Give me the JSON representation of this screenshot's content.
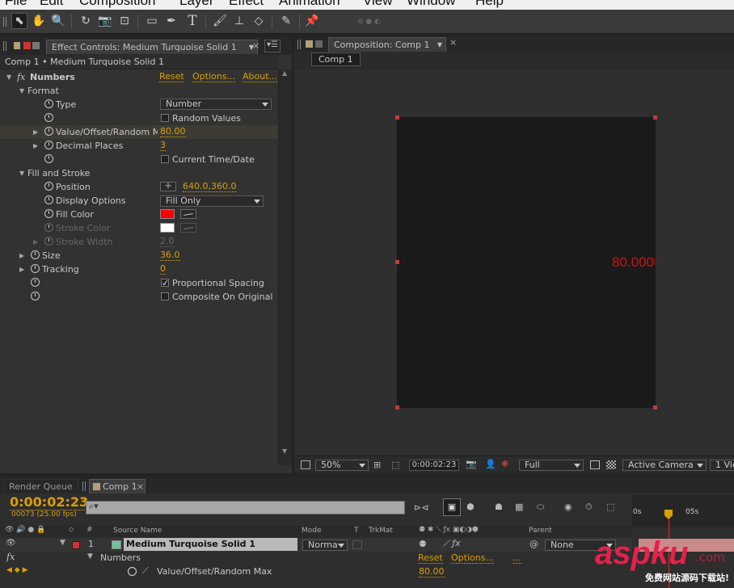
{
  "menu": [
    "File",
    "Edit",
    "Composition",
    "Layer",
    "Effect",
    "Animation",
    "View",
    "Window",
    "Help"
  ],
  "toolbar": {
    "tools": [
      "selection-tool",
      "hand-tool",
      "zoom-tool",
      "rotation-tool",
      "camera-tool",
      "pan-behind-tool",
      "rectangle-tool",
      "pen-tool",
      "type-tool",
      "brush-tool",
      "clone-stamp-tool",
      "eraser-tool",
      "roto-brush-tool",
      "puppet-pin-tool"
    ],
    "glyphs": [
      "⬉",
      "✋",
      "🔍",
      "↻",
      "📷",
      "⊡",
      "▭",
      "✒",
      "T",
      "🖌",
      "⊥",
      "◇",
      "✎",
      "📌"
    ]
  },
  "effect_controls": {
    "tab_title": "Effect Controls: Medium Turquoise Solid 1",
    "breadcrumb": "Comp 1 • Medium Turquoise Solid 1",
    "effect": {
      "name": "Numbers",
      "fx": "fx",
      "reset": "Reset",
      "options": "Options...",
      "about": "About..."
    },
    "groups": {
      "format": "Format",
      "fill_and_stroke": "Fill and Stroke"
    },
    "properties": {
      "type_label": "Type",
      "type_value": "Number",
      "random_values": "Random Values",
      "value_label": "Value/Offset/Random Ma",
      "value_value": "80.00",
      "decimal_label": "Decimal Places",
      "decimal_value": "3",
      "current_time": "Current Time/Date",
      "position_label": "Position",
      "position_value": "640.0,360.0",
      "display_label": "Display Options",
      "display_value": "Fill Only",
      "fill_color_label": "Fill Color",
      "fill_color": "#ff0000",
      "stroke_color_label": "Stroke Color",
      "stroke_color": "#ffffff",
      "stroke_width_label": "Stroke Width",
      "stroke_width_value": "2.0",
      "size_label": "Size",
      "size_value": "36.0",
      "tracking_label": "Tracking",
      "tracking_value": "0",
      "proportional": "Proportional Spacing",
      "composite": "Composite On Original"
    }
  },
  "composition": {
    "tab_title": "Composition: Comp 1",
    "sub_tab": "Comp 1",
    "canvas_text": "80.000",
    "canvas_text_color": "#cc1111",
    "footer": {
      "zoom": "50%",
      "timecode": "0:00:02:23",
      "resolution": "Full",
      "camera": "Active Camera",
      "views": "1 Vie"
    }
  },
  "timeline": {
    "tabs": [
      "Render Queue",
      "Comp 1"
    ],
    "timecode": "0:00:02:23",
    "frame_info": "00073 (25.00 fps)",
    "search_placeholder": "",
    "columns": {
      "source_name": "Source Name",
      "mode": "Mode",
      "t": "T",
      "trkmat": "TrkMat",
      "parent": "Parent"
    },
    "ruler": [
      "0s",
      "05s"
    ],
    "layer": {
      "number": "1",
      "name": "Medium Turquoise Solid 1",
      "mode": "Norma",
      "parent": "None",
      "label_color": "#6fc3a0"
    },
    "effect_row": {
      "fx": "fx",
      "name": "Numbers",
      "reset": "Reset",
      "options": "Options...",
      "more": "..."
    },
    "property_row": {
      "name": "Value/Offset/Random Max",
      "value": "80.00"
    }
  },
  "colors": {
    "accent": "#d8a000",
    "panel": "#323232",
    "highlight": "#d8a000"
  },
  "watermark": {
    "text": "aspku",
    "suffix": ".com",
    "caption": "免费网站源码下载站!"
  }
}
